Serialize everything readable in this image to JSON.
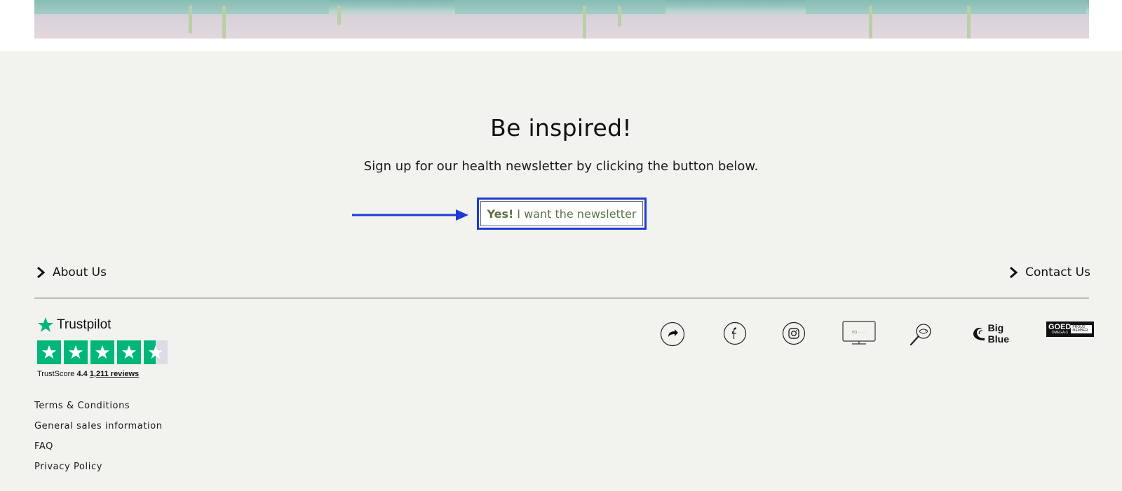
{
  "newsletter": {
    "title": "Be inspired!",
    "subtitle": "Sign up for our health newsletter by clicking the button below.",
    "button_bold": "Yes!",
    "button_rest": "I want the newsletter"
  },
  "footer": {
    "about_label": "About Us",
    "contact_label": "Contact Us"
  },
  "trustpilot": {
    "brand": "Trustpilot",
    "score_prefix": "TrustScore",
    "score": "4.4",
    "reviews": "1,211 reviews",
    "rating": 4.4
  },
  "legal": [
    "Terms & Conditions",
    "General sales information",
    "FAQ",
    "Privacy Policy"
  ],
  "badges": {
    "big_blue": "Big Blue",
    "goed": "GOED",
    "goed_sub": "OMEGA-3",
    "goed_member": "PROUD MEMBER"
  },
  "icons": [
    "share-icon",
    "facebook-icon",
    "instagram-icon",
    "tv-icon",
    "magnifier-fish-icon",
    "big-blue-logo",
    "goed-logo"
  ],
  "colors": {
    "background": "#f2f2ee",
    "button_border": "#1e3ad3",
    "button_text": "#5b7244",
    "trustpilot_green": "#00b67a",
    "arrow": "#1e3ad3"
  }
}
